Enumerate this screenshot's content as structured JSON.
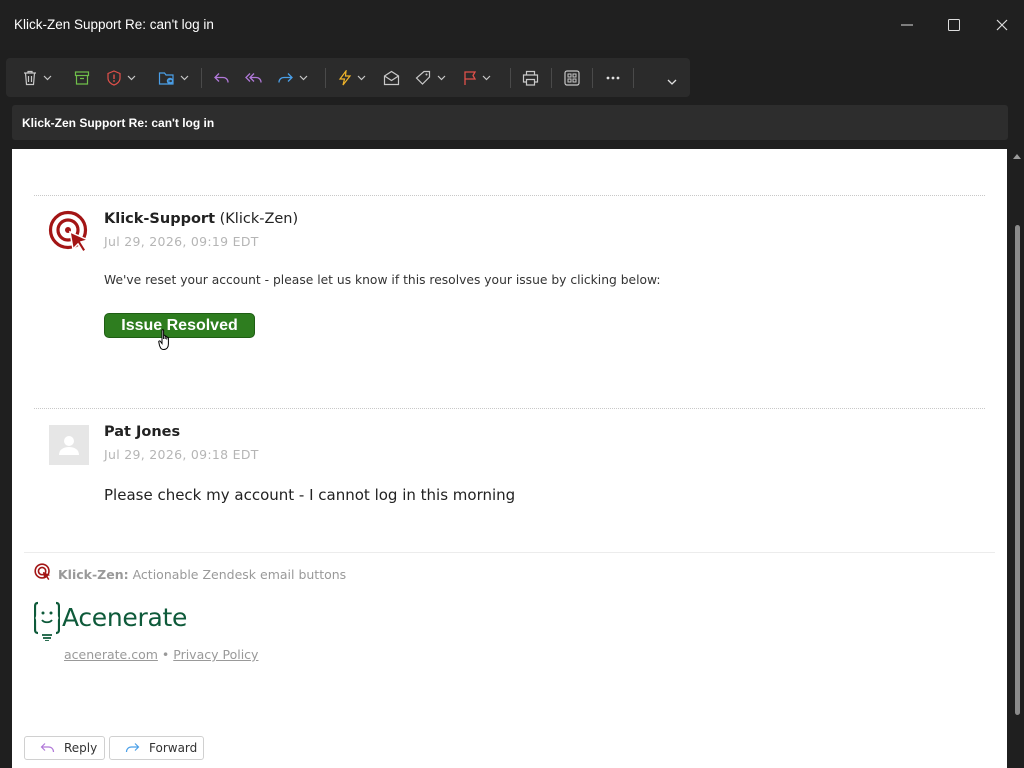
{
  "window": {
    "title": "Klick-Zen Support Re: can't log in"
  },
  "subject_bar": {
    "subject": "Klick-Zen Support Re: can't log in"
  },
  "toolbar": {
    "icons": [
      "delete-icon",
      "archive-icon",
      "report-icon",
      "move-icon",
      "reply-icon",
      "reply-all-icon",
      "forward-icon",
      "quick-steps-icon",
      "mark-read-icon",
      "tag-icon",
      "flag-icon",
      "print-icon",
      "apps-icon",
      "more-icon"
    ]
  },
  "messages": [
    {
      "sender_name": "Klick-Support",
      "sender_org": "(Klick-Zen)",
      "date": "Jul 29, 2026, 09:19 EDT",
      "body": "We've reset your account - please let us know if this resolves your issue by clicking below:",
      "button_label": "Issue Resolved"
    },
    {
      "sender_name": "Pat Jones",
      "date": "Jul 29, 2026, 09:18 EDT",
      "body": "Please check my account - I cannot log in this morning"
    }
  ],
  "footer": {
    "brand": "Klick-Zen:",
    "tagline": "Actionable Zendesk email buttons",
    "company": "Acenerate",
    "link_site": "acenerate.com",
    "separator": "•",
    "link_privacy": "Privacy Policy"
  },
  "actions": {
    "reply": "Reply",
    "forward": "Forward"
  },
  "colors": {
    "resolve_button": "#2e7d1f",
    "klick_red": "#a31515",
    "acenerate_green": "#0e5a3a"
  }
}
